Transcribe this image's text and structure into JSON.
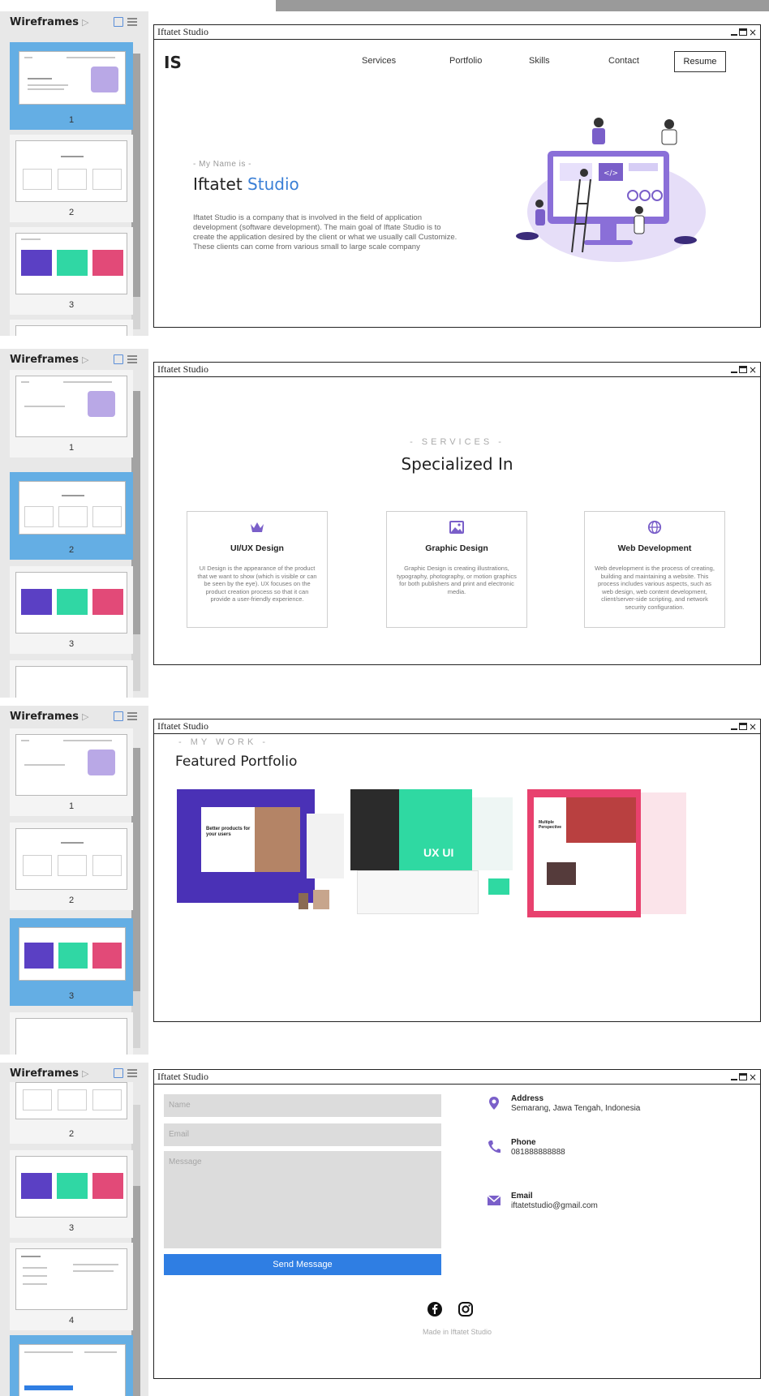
{
  "sidebar": {
    "title": "Wireframes",
    "page_numbers": [
      "1",
      "2",
      "3",
      "4"
    ]
  },
  "window": {
    "title": "Iftatet Studio"
  },
  "home": {
    "logo": "IS",
    "nav": [
      "Services",
      "Portfolio",
      "Skills",
      "Contact"
    ],
    "resume": "Resume",
    "eyebrow": "- My Name is -",
    "title_main": "Iftatet",
    "title_accent": "Studio",
    "body": "Iftatet Studio is a company that is involved in the field of application development (software development). The main goal of Iftate Studio is to create the application desired by the client or what we usually call Customize. These clients can come from various small to large scale company"
  },
  "services": {
    "eyebrow": "- SERVICES -",
    "title": "Specialized In",
    "cards": [
      {
        "name": "UI/UX Design",
        "desc": "UI Design is the appearance of the product that we want to show (which is visible or can be seen by the eye). UX focuses on the product creation process so that it can provide a user-friendly experience."
      },
      {
        "name": "Graphic Design",
        "desc": "Graphic Design is creating illustrations, typography, photography, or motion graphics for both publishers and print and electronic media."
      },
      {
        "name": "Web Development",
        "desc": "Web development is the process of creating, building and maintaining a website. This process includes various aspects, such as web design, web content development, client/server-side scripting, and network security configuration."
      }
    ]
  },
  "portfolio": {
    "eyebrow": "- MY WORK -",
    "title": "Featured Portfolio",
    "thumb1_text": "Better products for your users",
    "thumb2_text": "UX UI",
    "thumb3_text": "Multiple Perspective"
  },
  "contact": {
    "placeholders": {
      "name": "Name",
      "email": "Email",
      "message": "Message"
    },
    "send": "Send Message",
    "address": {
      "label": "Address",
      "value": "Semarang, Jawa Tengah, Indonesia"
    },
    "phone": {
      "label": "Phone",
      "value": "081888888888"
    },
    "email": {
      "label": "Email",
      "value": "iftatetstudio@gmail.com"
    },
    "footer": "Made in Iftatet Studio"
  },
  "colors": {
    "accent": "#3a7fd6",
    "button": "#2f7ee3",
    "sidebar_active": "#64aee4",
    "illustration": "#7a5fc9"
  },
  "icons": [
    "crown-icon",
    "image-icon",
    "globe-icon",
    "location-pin-icon",
    "phone-icon",
    "mail-icon",
    "facebook-icon",
    "instagram-icon"
  ]
}
